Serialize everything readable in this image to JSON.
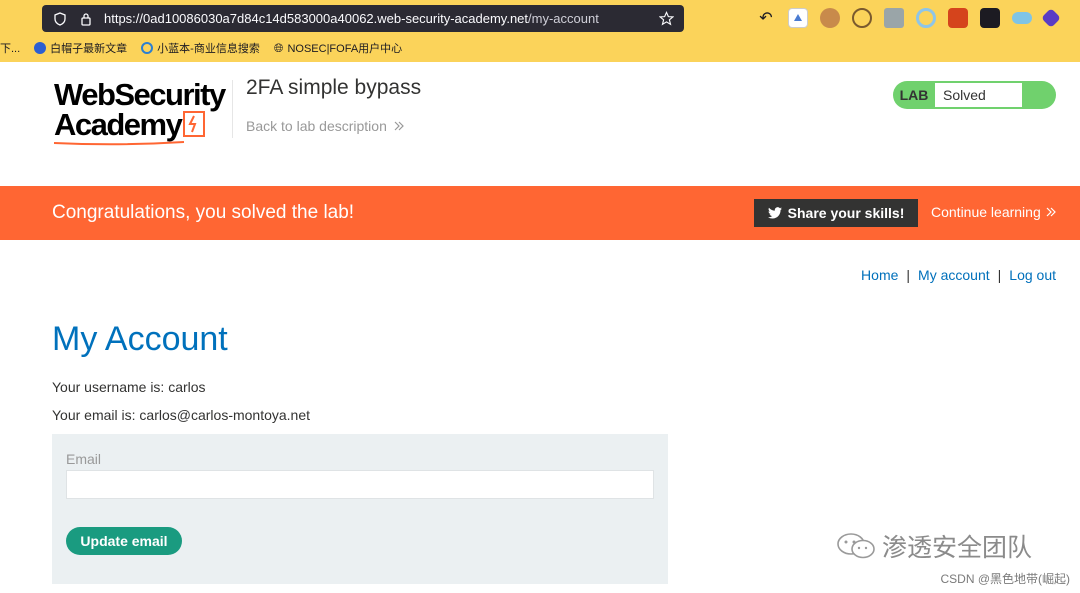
{
  "browser": {
    "url_main": "https://0ad10086030a7d84c14d583000a40062.",
    "url_domain": "web-security-academy.net",
    "url_path": "/my-account",
    "bookmarks": [
      {
        "label": "下..."
      },
      {
        "label": "白帽子最新文章"
      },
      {
        "label": "小蓝本-商业信息搜索"
      },
      {
        "label": "NOSEC|FOFA用户中心"
      }
    ]
  },
  "header": {
    "logo_line1": "WebSecurity",
    "logo_line2": "Academy",
    "lab_title": "2FA simple bypass",
    "back_link": "Back to lab description",
    "lab_badge_label": "LAB",
    "lab_badge_status": "Solved"
  },
  "banner": {
    "message": "Congratulations, you solved the lab!",
    "share_label": "Share your skills!",
    "continue_label": "Continue learning"
  },
  "nav": {
    "home": "Home",
    "separator": "|",
    "my_account": "My account",
    "log_out": "Log out"
  },
  "account": {
    "heading": "My Account",
    "username_line": "Your username is: carlos",
    "email_line": "Your email is: carlos@carlos-montoya.net",
    "email_label": "Email",
    "email_value": "",
    "update_label": "Update email"
  },
  "watermark": {
    "primary": "渗透安全团队",
    "secondary": "CSDN @黑色地带(崛起)"
  },
  "colors": {
    "accent_orange": "#ff6633",
    "link_blue": "#0070bb",
    "heading_blue": "#0071bc",
    "solved_green": "#70d16d",
    "button_teal": "#1a9b80",
    "browser_bar": "#fbd35a"
  }
}
